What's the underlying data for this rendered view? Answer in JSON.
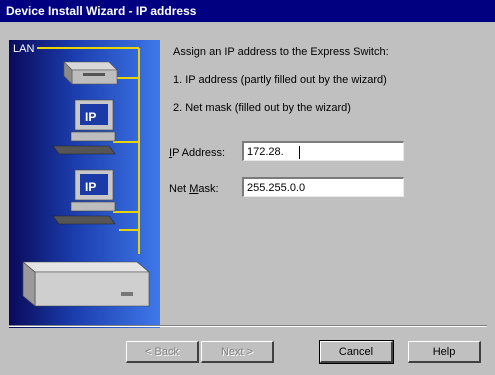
{
  "window": {
    "title": "Device Install Wizard - IP address"
  },
  "illustration": {
    "lan_label": "LAN",
    "ip_badge": "IP"
  },
  "instructions": {
    "heading": "Assign an IP address to the Express Switch:",
    "step1": "1. IP address (partly filled out by the wizard)",
    "step2": "2. Net mask (filled out by the wizard)"
  },
  "fields": {
    "ip_address": {
      "label_prefix": "",
      "label_mnemonic": "I",
      "label_rest": "P Address:",
      "value": "172.28."
    },
    "net_mask": {
      "label_prefix": "Net ",
      "label_mnemonic": "M",
      "label_rest": "ask:",
      "value": "255.255.0.0"
    }
  },
  "buttons": {
    "back": "< Back",
    "next": "Next >",
    "cancel": "Cancel",
    "help": "Help"
  },
  "colors": {
    "titlebar": "#000080",
    "dialog_bg": "#c0c0c0",
    "lan_cable": "#e8d400"
  }
}
